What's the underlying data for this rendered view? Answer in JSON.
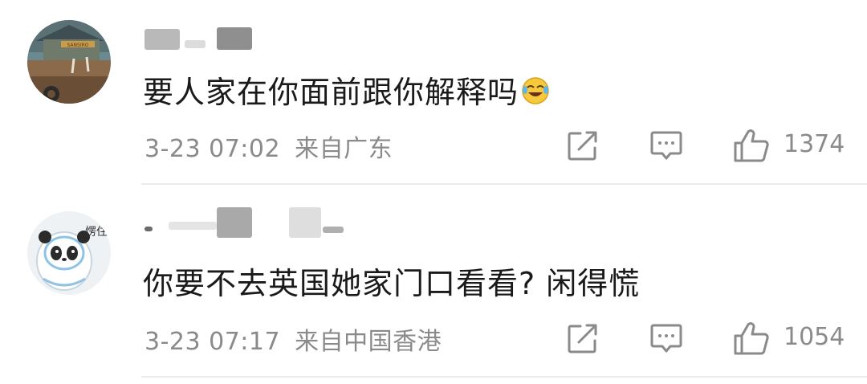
{
  "comments": [
    {
      "text": "要人家在你面前跟你解释吗",
      "emoji": "laugh-cry-emoji",
      "date": "3-23 07:02",
      "location": "来自广东",
      "likes": "1374",
      "avatar_text": "SANSIRO"
    },
    {
      "text": "你要不去英国她家门口看看? 闲得慌",
      "date": "3-23 07:17",
      "location": "来自中国香港",
      "likes": "1054",
      "avatar_text": "愣住"
    }
  ],
  "icons": {
    "repost": "repost-icon",
    "reply": "comment-icon",
    "like": "thumbs-up-icon"
  }
}
